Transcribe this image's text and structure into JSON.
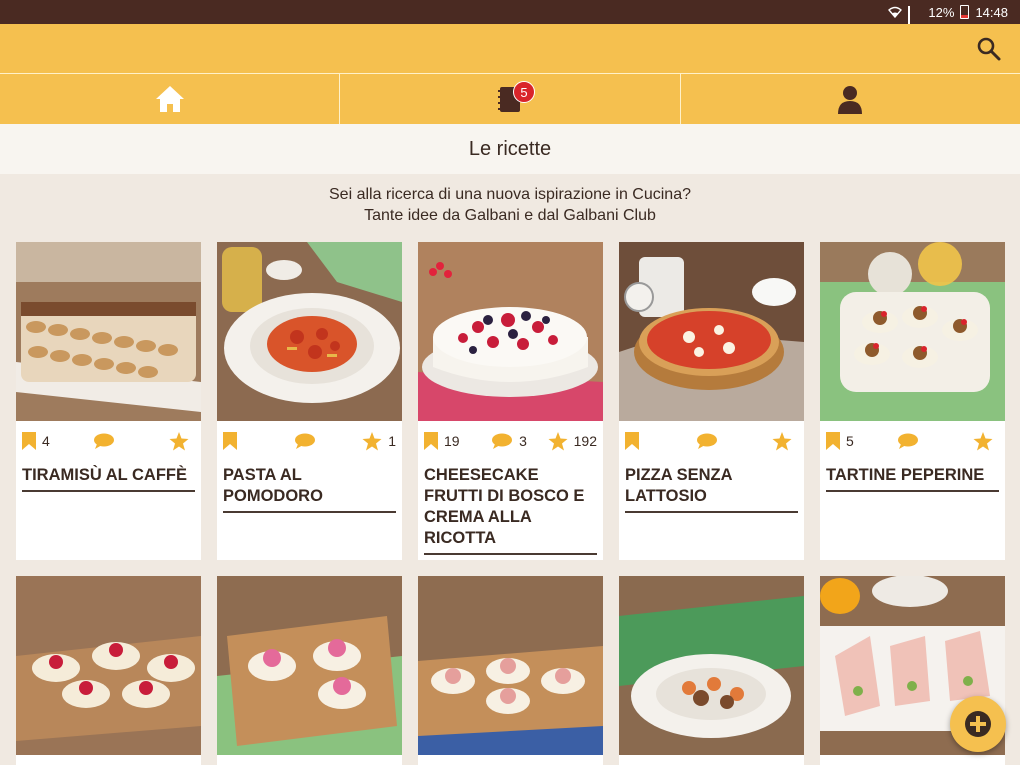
{
  "status_bar": {
    "battery": "12%",
    "time": "14:48"
  },
  "nav": {
    "tabs": [
      {
        "name": "home"
      },
      {
        "name": "recipe-book",
        "badge": "5"
      },
      {
        "name": "profile"
      }
    ]
  },
  "page_title": "Le ricette",
  "intro": {
    "line1": "Sei alla ricerca di una nuova ispirazione in Cucina?",
    "line2": "Tante idee da Galbani e dal Galbani Club"
  },
  "colors": {
    "accent": "#f5c04f",
    "text": "#3a2a22",
    "status_bar": "#4a2a22",
    "badge": "#d9252a"
  },
  "recipes": [
    {
      "title": "TIRAMISÙ AL CAFFÈ",
      "saves": "4",
      "comments": "",
      "rating": ""
    },
    {
      "title": "PASTA AL POMODORO",
      "saves": "",
      "comments": "",
      "rating": "1"
    },
    {
      "title": "CHEESECAKE FRUTTI DI BOSCO E CREMA ALLA RICOTTA",
      "saves": "19",
      "comments": "3",
      "rating": "192"
    },
    {
      "title": "PIZZA SENZA LATTOSIO",
      "saves": "",
      "comments": "",
      "rating": ""
    },
    {
      "title": "TARTINE PEPERINE",
      "saves": "5",
      "comments": "",
      "rating": ""
    }
  ]
}
